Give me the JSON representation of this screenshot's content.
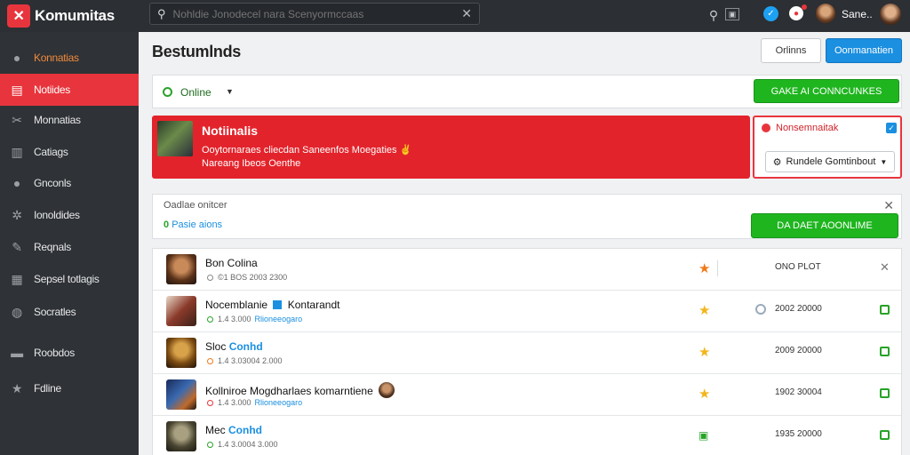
{
  "app": {
    "title": "Komumitas"
  },
  "search": {
    "placeholder": "Nohldie Jonodecel nara Scenyormccaas"
  },
  "topbar": {
    "user_name": "Sane.."
  },
  "sidebar": {
    "items": [
      {
        "label": "Konnatias",
        "icon": "comment-icon"
      },
      {
        "label": "Notiides",
        "icon": "inbox-icon"
      },
      {
        "label": "Monnatias",
        "icon": "tools-icon"
      },
      {
        "label": "Catiags",
        "icon": "grid-icon"
      },
      {
        "label": "Gnconls",
        "icon": "circle-icon"
      },
      {
        "label": "Ionoldides",
        "icon": "gear-icon"
      },
      {
        "label": "Reqnals",
        "icon": "wrench-icon"
      },
      {
        "label": "Sepsel totlagis",
        "icon": "book-icon"
      },
      {
        "label": "Socratles",
        "icon": "globe-icon"
      },
      {
        "label": "Roobdos",
        "icon": "folder-icon"
      },
      {
        "label": "Fdline",
        "icon": "star-icon"
      }
    ]
  },
  "main": {
    "title": "Bestumlnds",
    "header_buttons": {
      "secondary": "Orlinns",
      "primary": "Oonmanatien"
    },
    "status": {
      "label": "Online",
      "action": "GAKE AI CONNCUNKES"
    },
    "alert": {
      "title": "Notiinalis",
      "line1": "Ooytornaraes cliecdan Saneenfos Moegaties",
      "emoji": "✌",
      "line2": "Nareang Ibeos Oenthe"
    },
    "notice": {
      "title": "Nonsemnaitak",
      "select": "Rundele Gomtinbout"
    },
    "online_panel": {
      "header": "Oadlae onitcer",
      "sub": "Pasie aions",
      "action": "DA DAET AOONLIME"
    },
    "rows": [
      {
        "title": "Bon Colina",
        "meta": "©1 BOS 2003 2300",
        "value": "ONO PLOT"
      },
      {
        "title": "Nocemblanie",
        "title_badge": "Kontarandt",
        "meta": "1.4 3.000",
        "link": "Rlioneeogaro",
        "value": "2002 20000"
      },
      {
        "title": "Sloc",
        "title_hl": "Conhd",
        "meta": "1.4 3.03004 2.000",
        "value": "2009 20000"
      },
      {
        "title": "Kollniroe Mogdharlaes komarntiene",
        "meta": "1.4 3.000",
        "link": "Rlioneeogaro",
        "value": "1902 30004"
      },
      {
        "title": "Mec",
        "title_hl": "Conhd",
        "meta": "1.4 3.0004 3.000",
        "value": "1935 20000"
      }
    ]
  }
}
